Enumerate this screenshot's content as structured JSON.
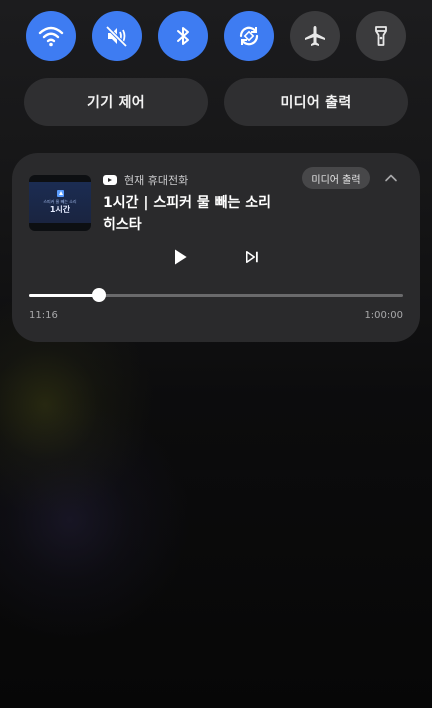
{
  "quick_toggles": [
    {
      "name": "wifi",
      "icon": "wifi-icon",
      "state": "on"
    },
    {
      "name": "sound",
      "icon": "mute-icon",
      "state": "on"
    },
    {
      "name": "bluetooth",
      "icon": "bluetooth-icon",
      "state": "on"
    },
    {
      "name": "auto-rotate",
      "icon": "rotate-icon",
      "state": "on"
    },
    {
      "name": "airplane-mode",
      "icon": "airplane-icon",
      "state": "off"
    },
    {
      "name": "flashlight",
      "icon": "flashlight-icon",
      "state": "off"
    }
  ],
  "colors": {
    "toggle_on": "#3e7cf2",
    "toggle_off": "#3b3b3d",
    "card_bg": "#2a2a2c"
  },
  "buttons": {
    "device_control": "기기 제어",
    "media_output": "미디어 출력"
  },
  "media": {
    "source_icon": "youtube-icon",
    "source_label": "현재 휴대전화",
    "output_chip": "미디어 출력",
    "thumbnail": {
      "line1": "스피커 물 빼는 소리",
      "line2": "1시간"
    },
    "title": "1시간 | 스피커 물 빼는 소리",
    "artist": "히스타",
    "elapsed": "11:16",
    "duration": "1:00:00",
    "progress": 0.188
  }
}
